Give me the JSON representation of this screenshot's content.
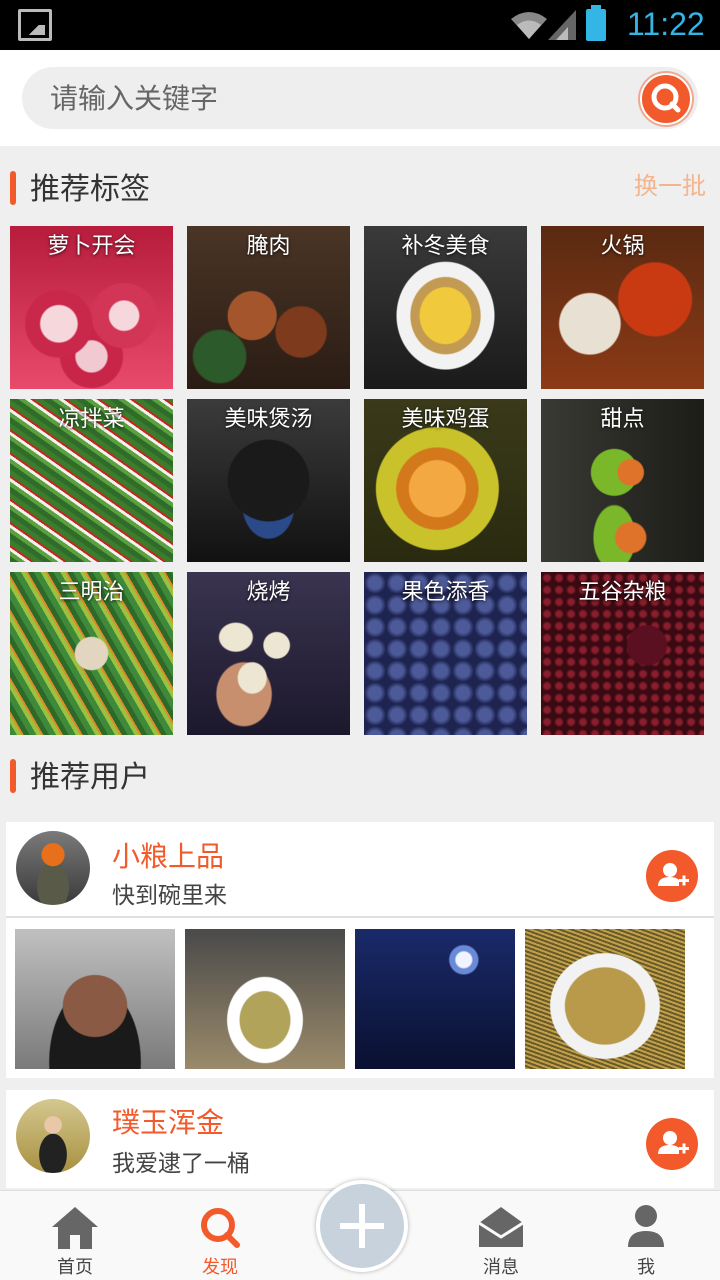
{
  "status": {
    "time": "11:22"
  },
  "search": {
    "placeholder": "请输入关键字"
  },
  "tags_section": {
    "title": "推荐标签",
    "refresh": "换一批"
  },
  "tags": [
    {
      "label": "萝卜开会"
    },
    {
      "label": "腌肉"
    },
    {
      "label": "补冬美食"
    },
    {
      "label": "火锅"
    },
    {
      "label": "凉拌菜"
    },
    {
      "label": "美味煲汤"
    },
    {
      "label": "美味鸡蛋"
    },
    {
      "label": "甜点"
    },
    {
      "label": "三明治"
    },
    {
      "label": "烧烤"
    },
    {
      "label": "果色添香"
    },
    {
      "label": "五谷杂粮"
    }
  ],
  "users_section": {
    "title": "推荐用户"
  },
  "users": [
    {
      "name": "小粮上品",
      "bio": "快到碗里来"
    },
    {
      "name": "璞玉浑金",
      "bio": "我爱逮了一桶"
    }
  ],
  "nav": [
    {
      "label": "首页"
    },
    {
      "label": "发现"
    },
    {
      "label": "消息"
    },
    {
      "label": "我"
    }
  ],
  "colors": {
    "accent": "#f25a2c",
    "status_text": "#33b5e5"
  }
}
